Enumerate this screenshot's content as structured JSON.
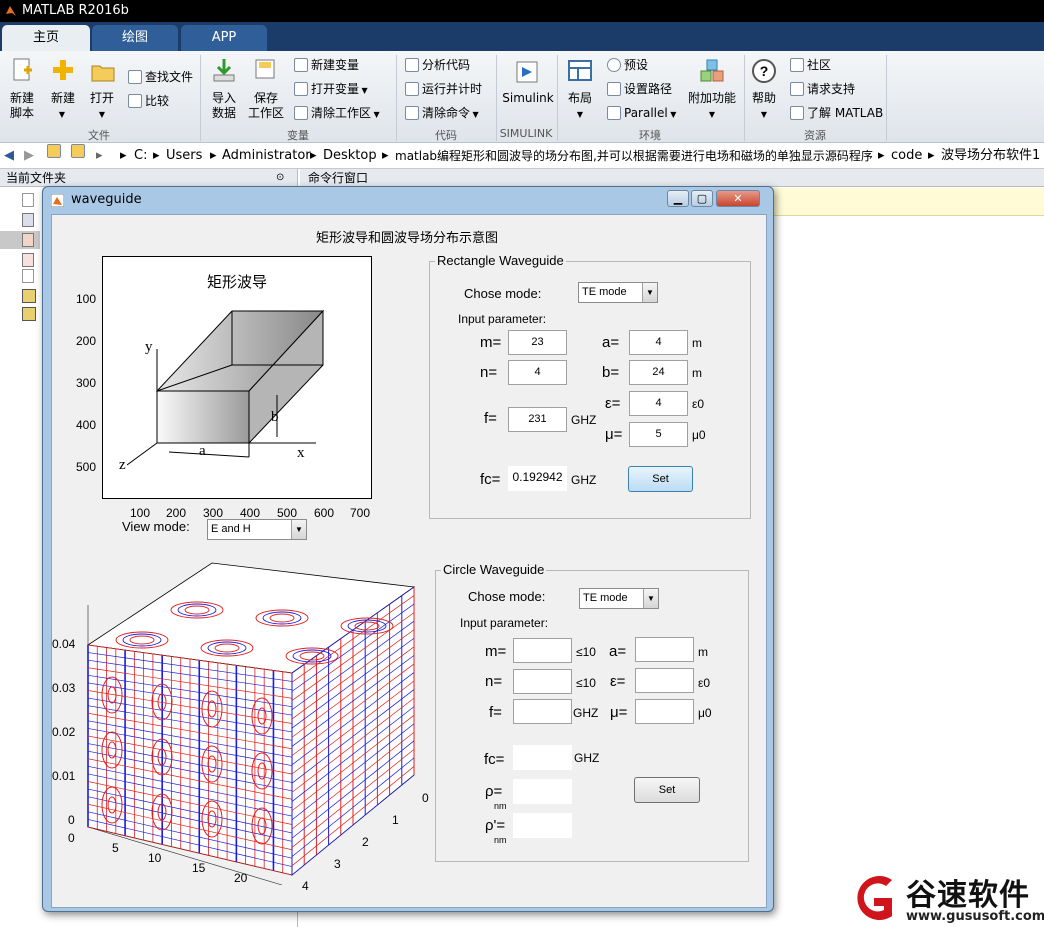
{
  "app": {
    "title": "MATLAB R2016b"
  },
  "tabs": [
    {
      "label": "主页"
    },
    {
      "label": "绘图"
    },
    {
      "label": "APP"
    }
  ],
  "ribbon": {
    "file": {
      "new_script": "新建\n脚本",
      "new": "新建",
      "open": "打开",
      "find_files": "查找文件",
      "compare": "比较",
      "group": "文件"
    },
    "variable": {
      "import": "导入\n数据",
      "save_ws": "保存\n工作区",
      "new_var": "新建变量",
      "open_var": "打开变量",
      "clear_ws": "清除工作区",
      "group": "变量"
    },
    "code": {
      "analyze": "分析代码",
      "run_time": "运行并计时",
      "clear_cmd": "清除命令",
      "group": "代码"
    },
    "simulink": {
      "label": "Simulink",
      "group": "SIMULINK"
    },
    "env": {
      "layout": "布局",
      "prefs": "预设",
      "set_path": "设置路径",
      "parallel": "Parallel",
      "addons": "附加功能",
      "group": "环境"
    },
    "resources": {
      "help": "帮助",
      "community": "社区",
      "support": "请求支持",
      "learn": "了解 MATLAB",
      "group": "资源"
    }
  },
  "address": {
    "crumbs": [
      "C:",
      "Users",
      "Administrator",
      "Desktop",
      "matlab编程矩形和圆波导的场分布图,并可以根据需要进行电场和磁场的单独显示源码程序",
      "code",
      "波导场分布软件1"
    ]
  },
  "panels": {
    "current_folder": "当前文件夹",
    "command_window": "命令行窗口"
  },
  "figure": {
    "title": "waveguide",
    "heading": "矩形波导和圆波导场分布示意图",
    "rect_diagram": {
      "title": "矩形波导",
      "labels": {
        "y": "y",
        "z": "z",
        "a": "a",
        "b": "b",
        "x": "x"
      },
      "y_ticks": [
        "100",
        "200",
        "300",
        "400",
        "500"
      ],
      "x_ticks": [
        "100",
        "200",
        "300",
        "400",
        "500",
        "600",
        "700"
      ]
    },
    "view_mode": {
      "label": "View mode:",
      "value": "E and H"
    },
    "plot3d": {
      "z_ticks": [
        "0.04",
        "0.03",
        "0.02",
        "0.01",
        "0"
      ],
      "x_ticks": [
        "0",
        "5",
        "10",
        "15",
        "20"
      ],
      "y_ticks": [
        "0",
        "1",
        "2",
        "3",
        "4"
      ]
    },
    "rect": {
      "title": "Rectangle Waveguide",
      "chose_mode": "Chose mode:",
      "mode": "TE mode",
      "input_param": "Input parameter:",
      "m_label": "m=",
      "m": "23",
      "n_label": "n=",
      "n": "4",
      "f_label": "f=",
      "f": "231",
      "f_unit": "GHZ",
      "a_label": "a=",
      "a": "4",
      "a_unit": "m",
      "b_label": "b=",
      "b": "24",
      "b_unit": "m",
      "eps_label": "ε=",
      "eps": "4",
      "eps_unit": "ε0",
      "mu_label": "μ=",
      "mu": "5",
      "mu_unit": "μ0",
      "fc_label": "fc=",
      "fc": "0.192942",
      "fc_unit": "GHZ",
      "set": "Set"
    },
    "circle": {
      "title": "Circle Waveguide",
      "chose_mode": "Chose mode:",
      "mode": "TE mode",
      "input_param": "Input parameter:",
      "m_label": "m=",
      "m_hint": "≤10",
      "n_label": "n=",
      "n_hint": "≤10",
      "f_label": "f=",
      "f_unit": "GHZ",
      "a_label": "a=",
      "a_unit": "m",
      "eps_label": "ε=",
      "eps_unit": "ε0",
      "mu_label": "μ=",
      "mu_unit": "μ0",
      "fc_label": "fc=",
      "fc_unit": "GHZ",
      "rho_label": "ρ=",
      "rho_sub": "nm",
      "rhop_label": "ρ'=",
      "rhop_sub": "nm",
      "set": "Set"
    }
  },
  "watermark": {
    "brand": "谷速软件",
    "url": "www.gususoft.com"
  },
  "colors": {
    "accent": "#1b3b68",
    "figure_border": "#a9c8e6",
    "field_red": "#e02020",
    "field_blue": "#1a1ae0"
  }
}
